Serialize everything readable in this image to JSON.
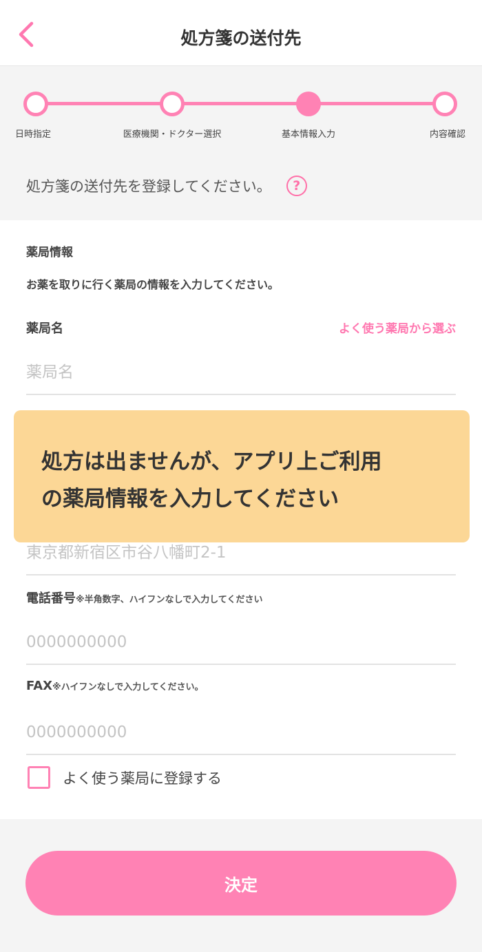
{
  "header": {
    "title": "処方箋の送付先",
    "back_icon": "chevron-left-icon"
  },
  "stepper": {
    "steps": [
      {
        "label": "日時指定",
        "state": "done"
      },
      {
        "label": "医療機関・ドクター選択",
        "state": "done"
      },
      {
        "label": "基本情報入力",
        "state": "active"
      },
      {
        "label": "内容確認",
        "state": "pending"
      }
    ],
    "accent": "#ff82b4"
  },
  "intro": {
    "text": "処方箋の送付先を登録してください。",
    "help_icon": "?"
  },
  "pharmacy": {
    "section_title": "薬局情報",
    "section_desc": "お薬を取りに行く薬局の情報を入力してください。",
    "name_label": "薬局名",
    "choose_link": "よく使う薬局から選ぶ",
    "name_placeholder": "薬局名",
    "address_placeholder": "東京都新宿区市谷八幡町2-1",
    "phone_label": "電話番号",
    "phone_note": "※半角数字、ハイフンなしで入力してください",
    "phone_placeholder": "0000000000",
    "fax_label": "FAX",
    "fax_note": "※ハイフンなしで入力してください。",
    "fax_placeholder": "0000000000",
    "save_checkbox_label": "よく使う薬局に登録する"
  },
  "overlay": {
    "line1": "処方は出ませんが、アプリ上ご利用",
    "line2": "の薬局情報を入力してください",
    "color": "#fcd796"
  },
  "submit": {
    "label": "決定"
  }
}
